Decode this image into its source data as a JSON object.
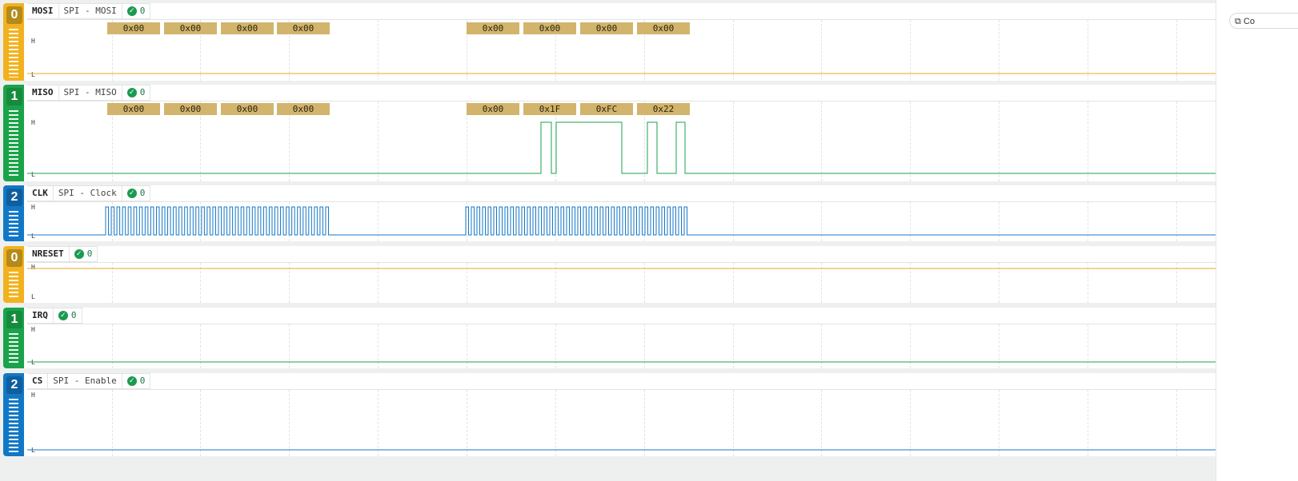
{
  "colors": {
    "yellow": "#f2b21e",
    "yellow_badge": "#b48a1a",
    "green": "#1aa34a",
    "green_badge": "#178a3d",
    "blue": "#1178c7",
    "blue_badge": "#0f5e9e",
    "byte_box": "#d2b46c",
    "trace_yellow": "#e8a820",
    "trace_green": "#1aa34a",
    "trace_blue": "#1477c7"
  },
  "channels": [
    {
      "number": "0",
      "name": "MOSI",
      "protocol": "SPI - MOSI",
      "status_count": "0",
      "color": "yellow",
      "high_label": "H",
      "low_label": "L",
      "decoded_bytes": [
        "0x00",
        "0x00",
        "0x00",
        "0x00",
        "0x00",
        "0x00",
        "0x00",
        "0x00"
      ]
    },
    {
      "number": "1",
      "name": "MISO",
      "protocol": "SPI - MISO",
      "status_count": "0",
      "color": "green",
      "high_label": "H",
      "low_label": "L",
      "decoded_bytes": [
        "0x00",
        "0x00",
        "0x00",
        "0x00",
        "0x00",
        "0x1F",
        "0xFC",
        "0x22"
      ]
    },
    {
      "number": "2",
      "name": "CLK",
      "protocol": "SPI - Clock",
      "status_count": "0",
      "color": "blue",
      "high_label": "H",
      "low_label": "L",
      "decoded_bytes": []
    },
    {
      "number": "0",
      "name": "NRESET",
      "protocol": "",
      "status_count": "0",
      "color": "yellow",
      "high_label": "H",
      "low_label": "L",
      "decoded_bytes": []
    },
    {
      "number": "1",
      "name": "IRQ",
      "protocol": "",
      "status_count": "0",
      "color": "green",
      "high_label": "H",
      "low_label": "L",
      "decoded_bytes": []
    },
    {
      "number": "2",
      "name": "CS",
      "protocol": "SPI - Enable",
      "status_count": "0",
      "color": "blue",
      "high_label": "H",
      "low_label": "L",
      "decoded_bytes": []
    }
  ],
  "right_panel": {
    "copy_label": "Co",
    "copy_icon": "copy-icon"
  }
}
